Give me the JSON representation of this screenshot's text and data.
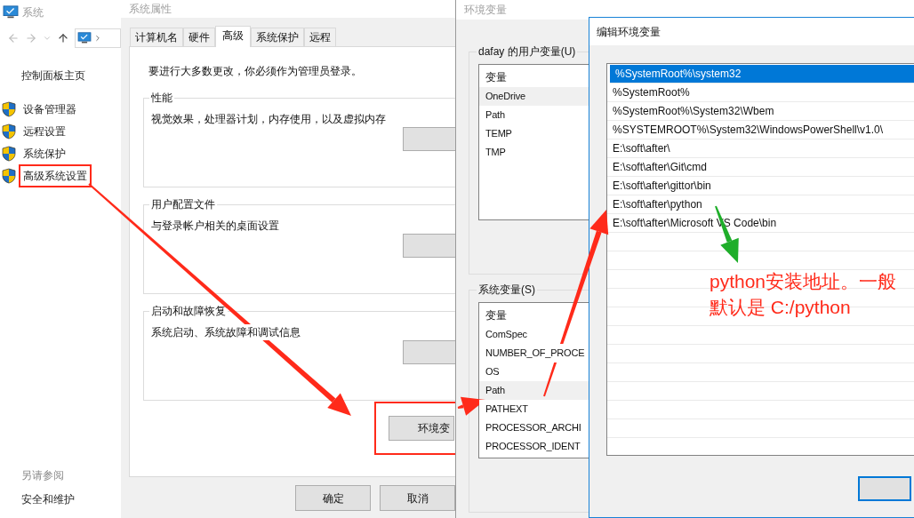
{
  "control_panel": {
    "title": "系统",
    "home_link": "控制面板主页",
    "tasks": [
      {
        "label": "设备管理器",
        "highlighted": false
      },
      {
        "label": "远程设置",
        "highlighted": false
      },
      {
        "label": "系统保护",
        "highlighted": false
      },
      {
        "label": "高级系统设置",
        "highlighted": true
      }
    ],
    "see_also_heading": "另请参阅",
    "see_also": [
      "安全和维护"
    ]
  },
  "system_properties": {
    "title": "系统属性",
    "tabs": [
      {
        "label": "计算机名",
        "selected": false
      },
      {
        "label": "硬件",
        "selected": false
      },
      {
        "label": "高级",
        "selected": true
      },
      {
        "label": "系统保护",
        "selected": false
      },
      {
        "label": "远程",
        "selected": false
      }
    ],
    "admin_note": "要进行大多数更改，你必须作为管理员登录。",
    "groups": [
      {
        "title": "性能",
        "description": "视觉效果，处理器计划，内存使用，以及虚拟内存"
      },
      {
        "title": "用户配置文件",
        "description": "与登录帐户相关的桌面设置"
      },
      {
        "title": "启动和故障恢复",
        "description": "系统启动、系统故障和调试信息"
      }
    ],
    "env_button": {
      "label": "环境变",
      "highlighted": true
    },
    "buttons": [
      "确定",
      "取消"
    ]
  },
  "environment_variables": {
    "title": "环境变量",
    "user_group": {
      "title": "dafay 的用户变量(U)",
      "column": "变量",
      "rows": [
        {
          "name": "OneDrive",
          "selected": true
        },
        {
          "name": "Path",
          "selected": false
        },
        {
          "name": "TEMP",
          "selected": false
        },
        {
          "name": "TMP",
          "selected": false
        }
      ]
    },
    "system_group": {
      "title": "系统变量(S)",
      "column": "变量",
      "rows": [
        {
          "name": "ComSpec",
          "selected": false
        },
        {
          "name": "NUMBER_OF_PROCE",
          "selected": false
        },
        {
          "name": "OS",
          "selected": false
        },
        {
          "name": "Path",
          "selected": true
        },
        {
          "name": "PATHEXT",
          "selected": false
        },
        {
          "name": "PROCESSOR_ARCHI",
          "selected": false
        },
        {
          "name": "PROCESSOR_IDENT",
          "selected": false
        }
      ]
    }
  },
  "edit_dialog": {
    "title": "编辑环境变量",
    "entries": [
      {
        "text": "%SystemRoot%\\system32",
        "selected": true
      },
      {
        "text": "%SystemRoot%",
        "selected": false
      },
      {
        "text": "%SystemRoot%\\System32\\Wbem",
        "selected": false
      },
      {
        "text": "%SYSTEMROOT%\\System32\\WindowsPowerShell\\v1.0\\",
        "selected": false
      },
      {
        "text": "E:\\soft\\after\\",
        "selected": false
      },
      {
        "text": "E:\\soft\\after\\Git\\cmd",
        "selected": false
      },
      {
        "text": "E:\\soft\\after\\gittor\\bin",
        "selected": false
      },
      {
        "text": "E:\\soft\\after\\python",
        "selected": false
      },
      {
        "text": "E:\\soft\\after\\Microsoft VS Code\\bin",
        "selected": false
      }
    ]
  },
  "annotation": {
    "note_lines": [
      "python安装地址。一般",
      "默认是 C:/python"
    ]
  }
}
